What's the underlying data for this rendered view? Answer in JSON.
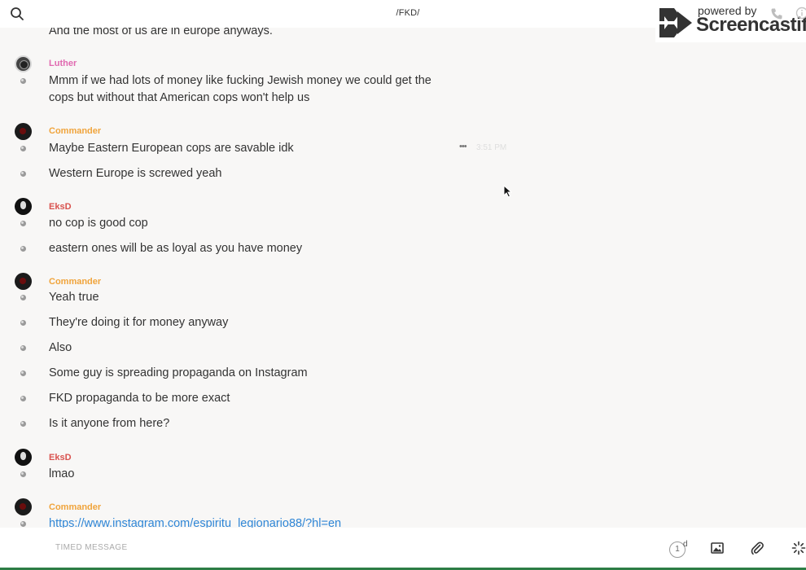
{
  "header": {
    "channel_title": "/FKD/",
    "search_icon": "search-icon"
  },
  "watermark": {
    "powered_by": "powered by",
    "brand": "Screencastify"
  },
  "conversation": {
    "previous_message": "And the most of us are in europe anyways.",
    "groups": [
      {
        "author": "Luther",
        "messages": [
          "Mmm if we had lots of money like fucking Jewish money we could get the cops but without that American cops won't help us"
        ]
      },
      {
        "author": "Commander",
        "messages": [
          "Maybe Eastern European cops are savable idk",
          "Western Europe is screwed yeah"
        ],
        "hover_time": "3:51 PM"
      },
      {
        "author": "EksD",
        "messages": [
          "no cop is good cop",
          "eastern ones will be as loyal as you have money"
        ]
      },
      {
        "author": "Commander",
        "messages": [
          "Yeah true",
          "They're doing it for money anyway",
          "Also",
          "Some guy is spreading propaganda on Instagram",
          "FKD propaganda to be more exact",
          "Is it anyone from here?"
        ]
      },
      {
        "author": "EksD",
        "messages": [
          "lmao"
        ]
      },
      {
        "author": "Commander",
        "messages": [
          "https://www.instagram.com/espiritu_legionario88/?hl=en"
        ]
      }
    ]
  },
  "composer": {
    "placeholder": "TIMED MESSAGE",
    "timer_value": "1",
    "timer_unit": "d"
  },
  "colors": {
    "luther": "#e069b0",
    "commander": "#f0a43c",
    "eksd": "#d9534f",
    "link": "#2f86d6",
    "background": "#f8f7f6"
  }
}
